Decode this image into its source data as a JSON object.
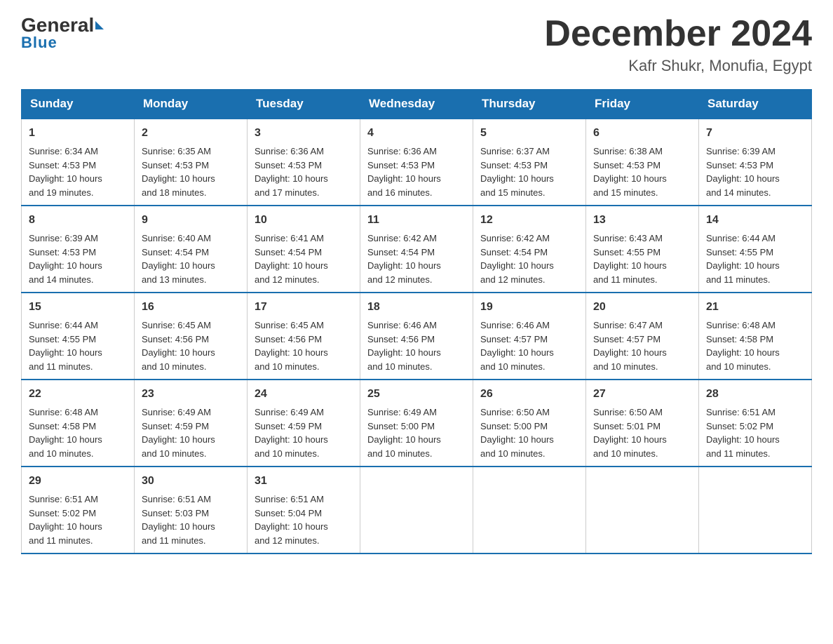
{
  "logo": {
    "general": "General",
    "blue": "Blue"
  },
  "title": "December 2024",
  "location": "Kafr Shukr, Monufia, Egypt",
  "days_of_week": [
    "Sunday",
    "Monday",
    "Tuesday",
    "Wednesday",
    "Thursday",
    "Friday",
    "Saturday"
  ],
  "weeks": [
    [
      {
        "day": "1",
        "sunrise": "6:34 AM",
        "sunset": "4:53 PM",
        "daylight": "10 hours and 19 minutes."
      },
      {
        "day": "2",
        "sunrise": "6:35 AM",
        "sunset": "4:53 PM",
        "daylight": "10 hours and 18 minutes."
      },
      {
        "day": "3",
        "sunrise": "6:36 AM",
        "sunset": "4:53 PM",
        "daylight": "10 hours and 17 minutes."
      },
      {
        "day": "4",
        "sunrise": "6:36 AM",
        "sunset": "4:53 PM",
        "daylight": "10 hours and 16 minutes."
      },
      {
        "day": "5",
        "sunrise": "6:37 AM",
        "sunset": "4:53 PM",
        "daylight": "10 hours and 15 minutes."
      },
      {
        "day": "6",
        "sunrise": "6:38 AM",
        "sunset": "4:53 PM",
        "daylight": "10 hours and 15 minutes."
      },
      {
        "day": "7",
        "sunrise": "6:39 AM",
        "sunset": "4:53 PM",
        "daylight": "10 hours and 14 minutes."
      }
    ],
    [
      {
        "day": "8",
        "sunrise": "6:39 AM",
        "sunset": "4:53 PM",
        "daylight": "10 hours and 14 minutes."
      },
      {
        "day": "9",
        "sunrise": "6:40 AM",
        "sunset": "4:54 PM",
        "daylight": "10 hours and 13 minutes."
      },
      {
        "day": "10",
        "sunrise": "6:41 AM",
        "sunset": "4:54 PM",
        "daylight": "10 hours and 12 minutes."
      },
      {
        "day": "11",
        "sunrise": "6:42 AM",
        "sunset": "4:54 PM",
        "daylight": "10 hours and 12 minutes."
      },
      {
        "day": "12",
        "sunrise": "6:42 AM",
        "sunset": "4:54 PM",
        "daylight": "10 hours and 12 minutes."
      },
      {
        "day": "13",
        "sunrise": "6:43 AM",
        "sunset": "4:55 PM",
        "daylight": "10 hours and 11 minutes."
      },
      {
        "day": "14",
        "sunrise": "6:44 AM",
        "sunset": "4:55 PM",
        "daylight": "10 hours and 11 minutes."
      }
    ],
    [
      {
        "day": "15",
        "sunrise": "6:44 AM",
        "sunset": "4:55 PM",
        "daylight": "10 hours and 11 minutes."
      },
      {
        "day": "16",
        "sunrise": "6:45 AM",
        "sunset": "4:56 PM",
        "daylight": "10 hours and 10 minutes."
      },
      {
        "day": "17",
        "sunrise": "6:45 AM",
        "sunset": "4:56 PM",
        "daylight": "10 hours and 10 minutes."
      },
      {
        "day": "18",
        "sunrise": "6:46 AM",
        "sunset": "4:56 PM",
        "daylight": "10 hours and 10 minutes."
      },
      {
        "day": "19",
        "sunrise": "6:46 AM",
        "sunset": "4:57 PM",
        "daylight": "10 hours and 10 minutes."
      },
      {
        "day": "20",
        "sunrise": "6:47 AM",
        "sunset": "4:57 PM",
        "daylight": "10 hours and 10 minutes."
      },
      {
        "day": "21",
        "sunrise": "6:48 AM",
        "sunset": "4:58 PM",
        "daylight": "10 hours and 10 minutes."
      }
    ],
    [
      {
        "day": "22",
        "sunrise": "6:48 AM",
        "sunset": "4:58 PM",
        "daylight": "10 hours and 10 minutes."
      },
      {
        "day": "23",
        "sunrise": "6:49 AM",
        "sunset": "4:59 PM",
        "daylight": "10 hours and 10 minutes."
      },
      {
        "day": "24",
        "sunrise": "6:49 AM",
        "sunset": "4:59 PM",
        "daylight": "10 hours and 10 minutes."
      },
      {
        "day": "25",
        "sunrise": "6:49 AM",
        "sunset": "5:00 PM",
        "daylight": "10 hours and 10 minutes."
      },
      {
        "day": "26",
        "sunrise": "6:50 AM",
        "sunset": "5:00 PM",
        "daylight": "10 hours and 10 minutes."
      },
      {
        "day": "27",
        "sunrise": "6:50 AM",
        "sunset": "5:01 PM",
        "daylight": "10 hours and 10 minutes."
      },
      {
        "day": "28",
        "sunrise": "6:51 AM",
        "sunset": "5:02 PM",
        "daylight": "10 hours and 11 minutes."
      }
    ],
    [
      {
        "day": "29",
        "sunrise": "6:51 AM",
        "sunset": "5:02 PM",
        "daylight": "10 hours and 11 minutes."
      },
      {
        "day": "30",
        "sunrise": "6:51 AM",
        "sunset": "5:03 PM",
        "daylight": "10 hours and 11 minutes."
      },
      {
        "day": "31",
        "sunrise": "6:51 AM",
        "sunset": "5:04 PM",
        "daylight": "10 hours and 12 minutes."
      },
      null,
      null,
      null,
      null
    ]
  ],
  "labels": {
    "sunrise": "Sunrise:",
    "sunset": "Sunset:",
    "daylight": "Daylight:"
  }
}
